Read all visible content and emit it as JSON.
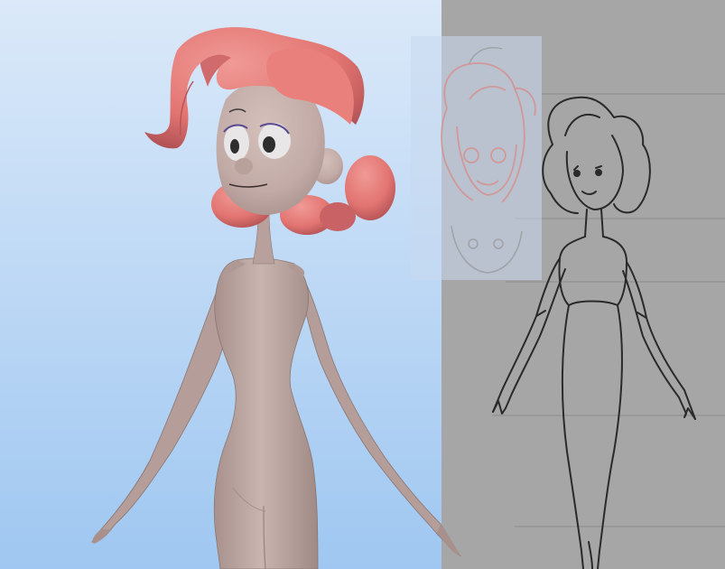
{
  "viewport": {
    "background_top": "#dbe9f9",
    "background_bottom": "#9fc7f1"
  },
  "model": {
    "skin_color": "#c2aba6",
    "skin_shadow": "#a08a85",
    "hair_color": "#e27471",
    "hair_shadow": "#b75558",
    "eye_white": "#e8e6e6",
    "iris_color": "#2e2e2e",
    "eyelid_color": "#5a4a90"
  },
  "reference_plane": {
    "background": "#a6a6a6",
    "line_color": "#2a2a2a",
    "guide_color": "#8a8a8a"
  },
  "reference_inset": {
    "tint": "#c8d9ee",
    "sketch_color": "#d98b88"
  }
}
